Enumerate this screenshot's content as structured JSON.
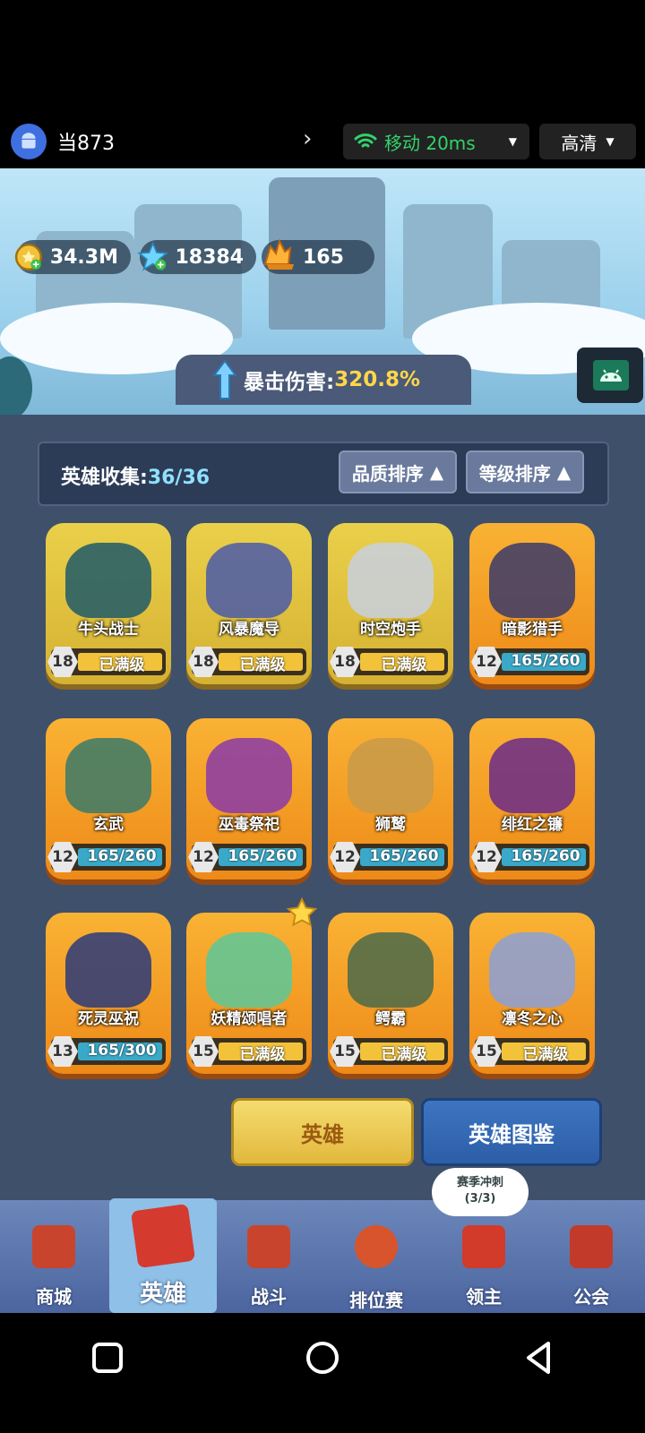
{
  "status": {
    "room_label": "当873",
    "network_label": "移动 20ms",
    "quality_label": "高清"
  },
  "resources": {
    "gold": "34.3M",
    "stars": "18384",
    "crystals": "165"
  },
  "crit": {
    "label": "暴击伤害:",
    "value": "320.8%"
  },
  "collection": {
    "label": "英雄收集:",
    "count": "36/36",
    "sort_quality": "品质排序",
    "sort_level": "等级排序"
  },
  "heroes": [
    {
      "name": "牛头战士",
      "level": "18",
      "progress": "已满级",
      "rarity": "gold"
    },
    {
      "name": "风暴魔导",
      "level": "18",
      "progress": "已满级",
      "rarity": "gold"
    },
    {
      "name": "时空炮手",
      "level": "18",
      "progress": "已满级",
      "rarity": "gold"
    },
    {
      "name": "暗影猎手",
      "level": "12",
      "progress": "165/260",
      "rarity": "orange"
    },
    {
      "name": "玄武",
      "level": "12",
      "progress": "165/260",
      "rarity": "orange"
    },
    {
      "name": "巫毒祭祀",
      "level": "12",
      "progress": "165/260",
      "rarity": "orange"
    },
    {
      "name": "狮鹫",
      "level": "12",
      "progress": "165/260",
      "rarity": "orange"
    },
    {
      "name": "绯红之镰",
      "level": "12",
      "progress": "165/260",
      "rarity": "orange"
    },
    {
      "name": "死灵巫祝",
      "level": "13",
      "progress": "165/300",
      "rarity": "orange"
    },
    {
      "name": "妖精颂唱者",
      "level": "15",
      "progress": "已满级",
      "rarity": "orange"
    },
    {
      "name": "鳄霸",
      "level": "15",
      "progress": "已满级",
      "rarity": "orange"
    },
    {
      "name": "凛冬之心",
      "level": "15",
      "progress": "已满级",
      "rarity": "orange"
    }
  ],
  "actions": {
    "hero": "英雄",
    "guide": "英雄图鉴"
  },
  "season_bubble": {
    "line1": "赛季冲刺",
    "line2": "(3/3)"
  },
  "tabs": [
    "商城",
    "英雄",
    "战斗",
    "排位赛",
    "领主",
    "公会"
  ]
}
